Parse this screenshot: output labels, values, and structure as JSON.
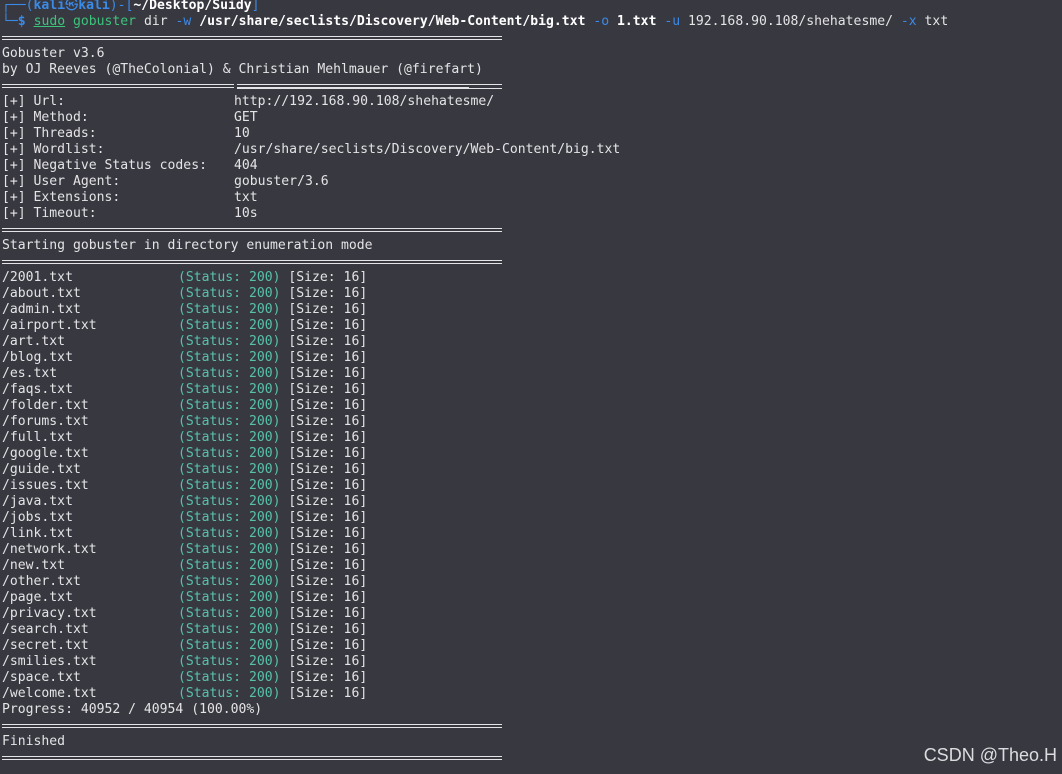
{
  "prompt": {
    "corner_top": "┌──(",
    "user": "kali",
    "at_glyph": "㉿",
    "host": "kali",
    "bracket_mid": ")-[",
    "cwd": "~/Desktop/Suidy",
    "bracket_end": "]",
    "corner_bottom": "└─",
    "dollar": "$"
  },
  "command": {
    "sudo": "sudo",
    "program": "gobuster",
    "mode": "dir",
    "flag_w": "-w",
    "wordlist": "/usr/share/seclists/Discovery/Web-Content/big.txt",
    "flag_o": "-o",
    "outfile": "1.txt",
    "flag_u": "-u",
    "url": "192.168.90.108/shehatesme/",
    "flag_x": "-x",
    "ext": "txt"
  },
  "banner": {
    "version": "Gobuster v3.6",
    "authors": "by OJ Reeves (@TheColonial) & Christian Mehlmauer (@firefart)"
  },
  "config": [
    {
      "key": "[+] Url:",
      "value": "http://192.168.90.108/shehatesme/"
    },
    {
      "key": "[+] Method:",
      "value": "GET"
    },
    {
      "key": "[+] Threads:",
      "value": "10"
    },
    {
      "key": "[+] Wordlist:",
      "value": "/usr/share/seclists/Discovery/Web-Content/big.txt"
    },
    {
      "key": "[+] Negative Status codes:",
      "value": "404"
    },
    {
      "key": "[+] User Agent:",
      "value": "gobuster/3.6"
    },
    {
      "key": "[+] Extensions:",
      "value": "txt"
    },
    {
      "key": "[+] Timeout:",
      "value": "10s"
    }
  ],
  "start_message": "Starting gobuster in directory enumeration mode",
  "results": [
    {
      "path": "/2001.txt",
      "status": "(Status: 200)",
      "size": "[Size: 16]"
    },
    {
      "path": "/about.txt",
      "status": "(Status: 200)",
      "size": "[Size: 16]"
    },
    {
      "path": "/admin.txt",
      "status": "(Status: 200)",
      "size": "[Size: 16]"
    },
    {
      "path": "/airport.txt",
      "status": "(Status: 200)",
      "size": "[Size: 16]"
    },
    {
      "path": "/art.txt",
      "status": "(Status: 200)",
      "size": "[Size: 16]"
    },
    {
      "path": "/blog.txt",
      "status": "(Status: 200)",
      "size": "[Size: 16]"
    },
    {
      "path": "/es.txt",
      "status": "(Status: 200)",
      "size": "[Size: 16]"
    },
    {
      "path": "/faqs.txt",
      "status": "(Status: 200)",
      "size": "[Size: 16]"
    },
    {
      "path": "/folder.txt",
      "status": "(Status: 200)",
      "size": "[Size: 16]"
    },
    {
      "path": "/forums.txt",
      "status": "(Status: 200)",
      "size": "[Size: 16]"
    },
    {
      "path": "/full.txt",
      "status": "(Status: 200)",
      "size": "[Size: 16]"
    },
    {
      "path": "/google.txt",
      "status": "(Status: 200)",
      "size": "[Size: 16]"
    },
    {
      "path": "/guide.txt",
      "status": "(Status: 200)",
      "size": "[Size: 16]"
    },
    {
      "path": "/issues.txt",
      "status": "(Status: 200)",
      "size": "[Size: 16]"
    },
    {
      "path": "/java.txt",
      "status": "(Status: 200)",
      "size": "[Size: 16]"
    },
    {
      "path": "/jobs.txt",
      "status": "(Status: 200)",
      "size": "[Size: 16]"
    },
    {
      "path": "/link.txt",
      "status": "(Status: 200)",
      "size": "[Size: 16]"
    },
    {
      "path": "/network.txt",
      "status": "(Status: 200)",
      "size": "[Size: 16]"
    },
    {
      "path": "/new.txt",
      "status": "(Status: 200)",
      "size": "[Size: 16]"
    },
    {
      "path": "/other.txt",
      "status": "(Status: 200)",
      "size": "[Size: 16]"
    },
    {
      "path": "/page.txt",
      "status": "(Status: 200)",
      "size": "[Size: 16]"
    },
    {
      "path": "/privacy.txt",
      "status": "(Status: 200)",
      "size": "[Size: 16]"
    },
    {
      "path": "/search.txt",
      "status": "(Status: 200)",
      "size": "[Size: 16]"
    },
    {
      "path": "/secret.txt",
      "status": "(Status: 200)",
      "size": "[Size: 16]"
    },
    {
      "path": "/smilies.txt",
      "status": "(Status: 200)",
      "size": "[Size: 16]"
    },
    {
      "path": "/space.txt",
      "status": "(Status: 200)",
      "size": "[Size: 16]"
    },
    {
      "path": "/welcome.txt",
      "status": "(Status: 200)",
      "size": "[Size: 16]"
    }
  ],
  "progress": "Progress: 40952 / 40954 (100.00%)",
  "finished": "Finished",
  "watermark": "CSDN @Theo.H",
  "colors": {
    "background": "#383841",
    "text": "#e4e4e6",
    "prompt_blue": "#3a8be8",
    "status_teal": "#58c2a8",
    "command_green": "#3bc47b"
  }
}
